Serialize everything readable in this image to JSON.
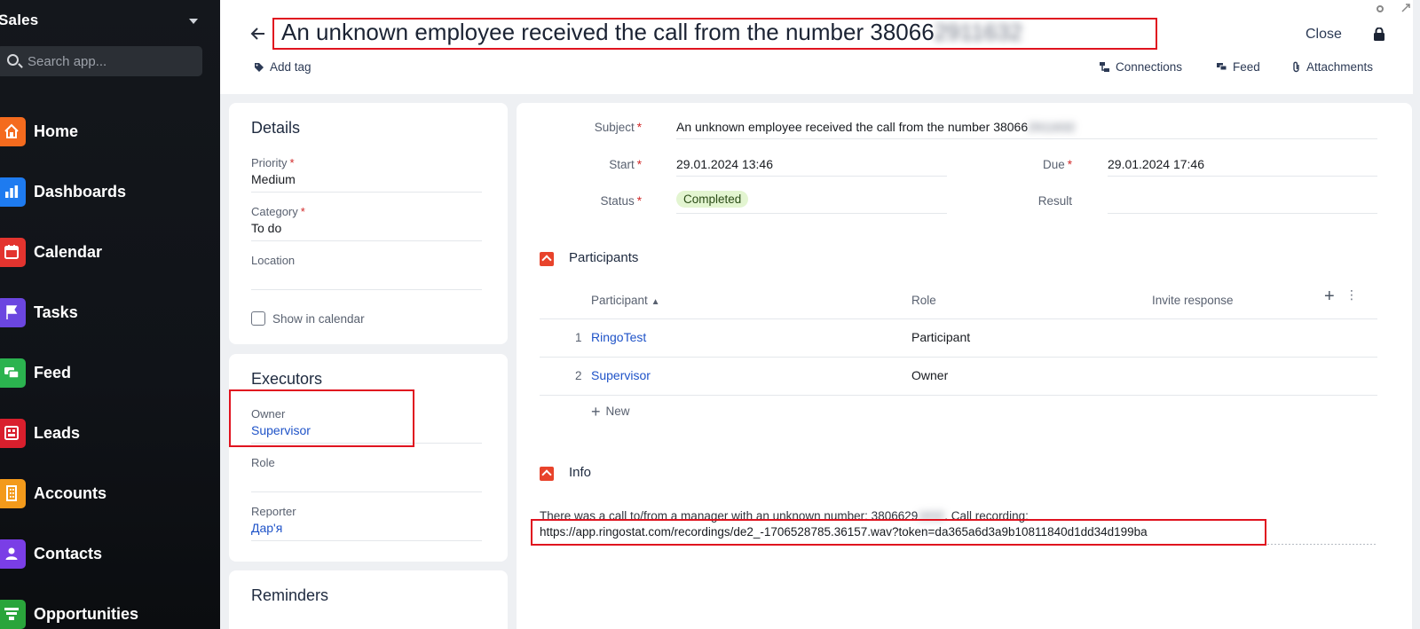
{
  "sidebar": {
    "title": "Sales",
    "search_placeholder": "Search app...",
    "items": [
      {
        "label": "Home",
        "icon": "home-icon",
        "color": "#f46b1e"
      },
      {
        "label": "Dashboards",
        "icon": "bar-chart-icon",
        "color": "#1e7bf0"
      },
      {
        "label": "Calendar",
        "icon": "calendar-icon",
        "color": "#e3342f"
      },
      {
        "label": "Tasks",
        "icon": "flag-icon",
        "color": "#6b46e0"
      },
      {
        "label": "Feed",
        "icon": "chat-icon",
        "color": "#2bb34f"
      },
      {
        "label": "Leads",
        "icon": "leads-icon",
        "color": "#d91f2d"
      },
      {
        "label": "Accounts",
        "icon": "building-icon",
        "color": "#f39a1b"
      },
      {
        "label": "Contacts",
        "icon": "person-icon",
        "color": "#7a3ee6"
      },
      {
        "label": "Opportunities",
        "icon": "funnel-icon",
        "color": "#2aa53b"
      }
    ]
  },
  "header": {
    "title_visible": "An unknown employee received the call from the number 38066",
    "title_blurred": "2911632",
    "add_tag": "Add tag",
    "close": "Close",
    "links": {
      "connections": "Connections",
      "feed": "Feed",
      "attachments": "Attachments"
    }
  },
  "details": {
    "heading": "Details",
    "priority_label": "Priority",
    "priority_value": "Medium",
    "category_label": "Category",
    "category_value": "To do",
    "location_label": "Location",
    "show_in_calendar": "Show in calendar"
  },
  "executors": {
    "heading": "Executors",
    "owner_label": "Owner",
    "owner_value": "Supervisor",
    "role_label": "Role",
    "reporter_label": "Reporter",
    "reporter_value": "Дар'я"
  },
  "reminders": {
    "heading": "Reminders"
  },
  "form": {
    "subject_label": "Subject",
    "subject_visible": "An unknown employee received the call from the number 38066",
    "subject_blurred": "2911632",
    "start_label": "Start",
    "start_value": "29.01.2024 13:46",
    "due_label": "Due",
    "due_value": "29.01.2024 17:46",
    "status_label": "Status",
    "status_value": "Completed",
    "result_label": "Result"
  },
  "participants": {
    "heading": "Participants",
    "columns": {
      "participant": "Participant",
      "role": "Role",
      "invite": "Invite response"
    },
    "rows": [
      {
        "n": "1",
        "name": "RingoTest",
        "role": "Participant"
      },
      {
        "n": "2",
        "name": "Supervisor",
        "role": "Owner"
      }
    ],
    "new_label": "New"
  },
  "info": {
    "heading": "Info",
    "text_visible": "There was a call to/from a manager with an unknown number: 3806629",
    "text_blurred": "1632",
    "text_tail": ". Call recording:",
    "url": "https://app.ringostat.com/recordings/de2_-1706528785.36157.wav?token=da365a6d3a9b10811840d1dd34d199ba"
  }
}
